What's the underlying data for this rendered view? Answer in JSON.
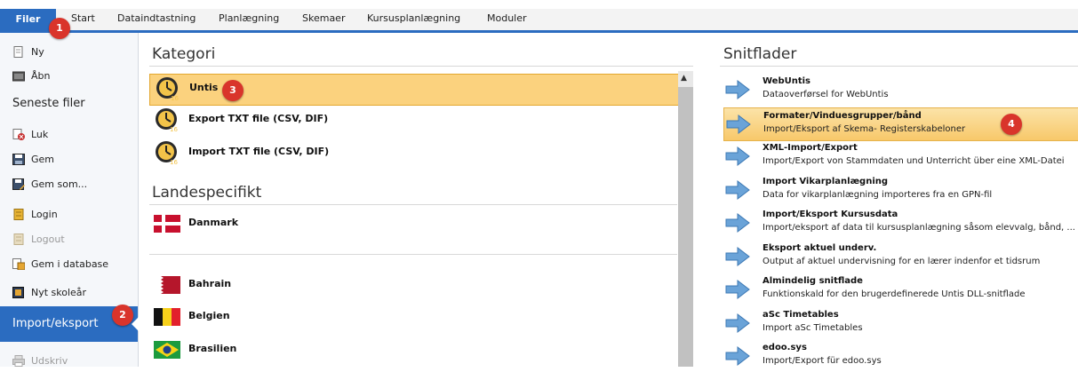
{
  "ribbon": {
    "file": "Filer",
    "tabs": [
      "Start",
      "Dataindtastning",
      "Planlægning",
      "Skemaer",
      "Kursusplanlægning",
      "Moduler"
    ]
  },
  "sidebar": {
    "items": {
      "new": "Ny",
      "open": "Åbn",
      "recent": "Seneste filer",
      "close": "Luk",
      "save": "Gem",
      "save_as": "Gem som...",
      "login": "Login",
      "logout": "Logout",
      "save_db": "Gem i database",
      "new_year": "Nyt skoleår",
      "import_export": "Import/eksport",
      "print": "Udskriv"
    }
  },
  "kategori": {
    "heading": "Kategori",
    "items": [
      "Untis",
      "Export TXT file (CSV, DIF)",
      "Import TXT file (CSV, DIF)"
    ]
  },
  "landespecifikt": {
    "heading": "Landespecifikt",
    "countries": [
      "Danmark",
      "Bahrain",
      "Belgien",
      "Brasilien"
    ]
  },
  "snitflader": {
    "heading": "Snitflader",
    "items": [
      {
        "title": "WebUntis",
        "desc": "Dataoverførsel for WebUntis"
      },
      {
        "title": "Formater/Vinduesgrupper/bånd",
        "desc": "Import/Eksport af Skema-  Registerskabeloner"
      },
      {
        "title": "XML-Import/Export",
        "desc": "Import/Export von Stammdaten und Unterricht über eine XML-Datei"
      },
      {
        "title": "Import Vikarplanlægning",
        "desc": "Data for vikarplanlægning importeres fra en GPN-fil"
      },
      {
        "title": "Import/Eksport Kursusdata",
        "desc": "Import/eksport af data til kursusplanlægning såsom elevvalg, bånd, ..."
      },
      {
        "title": "Eksport aktuel underv.",
        "desc": "Output af aktuel undervisning for en lærer indenfor et tidsrum"
      },
      {
        "title": "Almindelig snitflade",
        "desc": "Funktionskald for den brugerdefinerede Untis DLL-snitflade"
      },
      {
        "title": "aSc Timetables",
        "desc": "Import aSc Timetables"
      },
      {
        "title": "edoo.sys",
        "desc": "Import/Export für edoo.sys"
      }
    ]
  },
  "badges": [
    "1",
    "2",
    "3",
    "4"
  ],
  "colors": {
    "accent": "#2b6cc0",
    "selection": "#fbd27e",
    "badge": "#d9342b"
  }
}
